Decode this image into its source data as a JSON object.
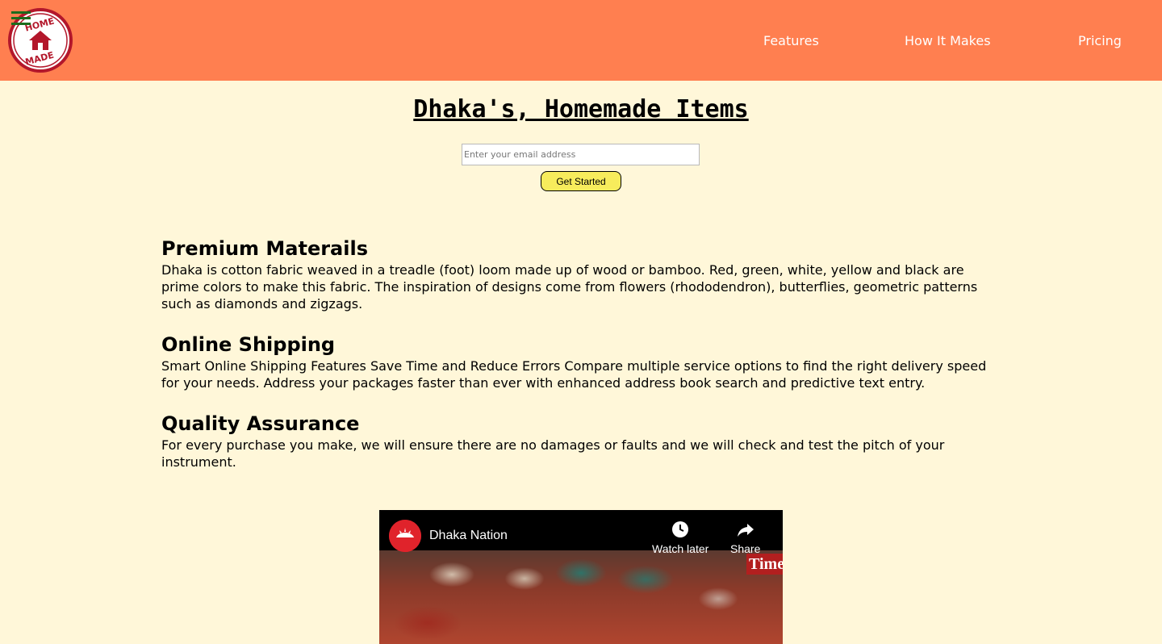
{
  "header": {
    "logo_text": "HOME MADE",
    "nav": [
      {
        "label": "Features"
      },
      {
        "label": "How It Makes"
      },
      {
        "label": "Pricing"
      }
    ]
  },
  "hero": {
    "title": "Dhaka's, Homemade Items",
    "email_placeholder": "Enter your email address",
    "cta_label": "Get Started"
  },
  "features": [
    {
      "title": "Premium Materails",
      "text": "Dhaka is cotton fabric weaved in a treadle (foot) loom made up of wood or bamboo. Red, green, white, yellow and black are prime colors to make this fabric. The inspiration of designs come from flowers (rhododendron), butterflies, geometric patterns such as diamonds and zigzags."
    },
    {
      "title": "Online Shipping",
      "text": "Smart Online Shipping Features Save Time and Reduce Errors Compare multiple service options to find the right delivery speed for your needs. Address your packages faster than ever with enhanced address book search and predictive text entry."
    },
    {
      "title": "Quality Assurance",
      "text": "For every purchase you make, we will ensure there are no damages or faults and we will check and test the pitch of your instrument."
    }
  ],
  "video": {
    "channel_title": "Dhaka Nation",
    "watch_later_label": "Watch later",
    "share_label": "Share",
    "badge_text": "Time"
  },
  "colors": {
    "header_bg": "#ff7f50",
    "page_bg": "#fff7d9",
    "cta_bg": "#f7ec5c",
    "logo_red": "#b3172b"
  }
}
